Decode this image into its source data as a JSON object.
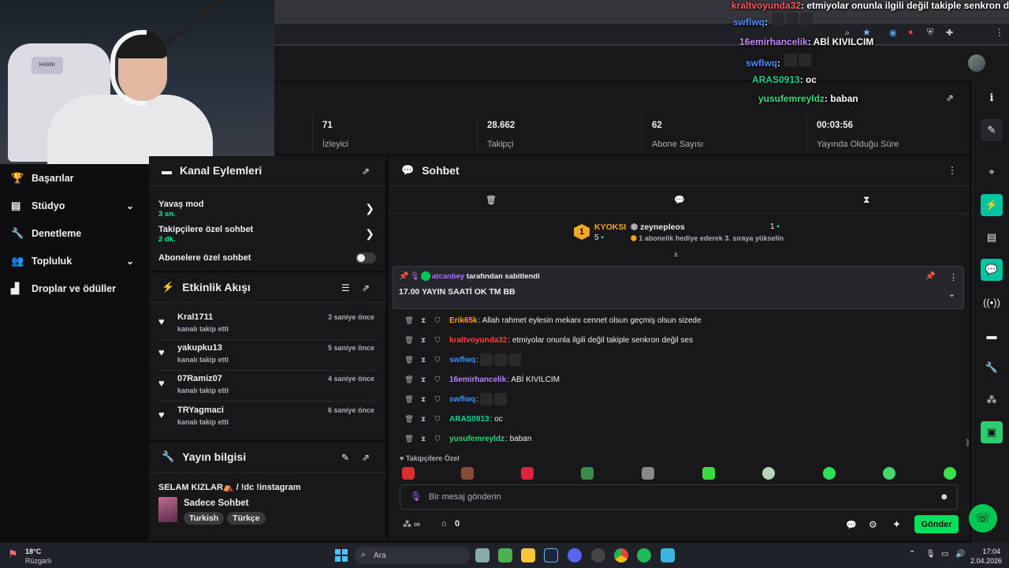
{
  "nav": [
    {
      "label": "Başarılar",
      "icon": "trophy-icon"
    },
    {
      "label": "Stüdyo",
      "icon": "studio-icon",
      "expand": true
    },
    {
      "label": "Denetleme",
      "icon": "wrench-icon"
    },
    {
      "label": "Topluluk",
      "icon": "community-icon",
      "expand": true
    },
    {
      "label": "Droplar ve ödüller",
      "icon": "drops-icon"
    }
  ],
  "stats": [
    {
      "value": "71",
      "label": "İzleyici"
    },
    {
      "value": "28.662",
      "label": "Takipçi"
    },
    {
      "value": "62",
      "label": "Abone Sayısı"
    },
    {
      "value": "00:03:56",
      "label": "Yayında Olduğu Süre"
    }
  ],
  "channel_actions": {
    "title": "Kanal Eylemleri",
    "slow_mode": {
      "label": "Yavaş mod",
      "value": "3 sn."
    },
    "followers_only": {
      "label": "Takipçilere özel sohbet",
      "value": "2 dk."
    },
    "subs_only": {
      "label": "Abonelere özel sohbet"
    }
  },
  "activity": {
    "title": "Etkinlik Akışı",
    "items": [
      {
        "name": "Kral1711",
        "sub": "kanalı takip etti",
        "time": "3 saniye önce"
      },
      {
        "name": "yakupku13",
        "sub": "kanalı takip etti",
        "time": "5 saniye önce"
      },
      {
        "name": "07Ramiz07",
        "sub": "kanalı takip etti",
        "time": "4 saniye önce"
      },
      {
        "name": "TRYagmaci",
        "sub": "kanalı takip etti",
        "time": "6 saniye önce"
      }
    ]
  },
  "stream_info": {
    "title_label": "Yayın bilgisi",
    "stream_title": "SELAM KIZLAR⛺ / !dc !instagram",
    "category": "Sadece Sohbet",
    "tags": [
      "Turkish",
      "Türkçe"
    ]
  },
  "chat": {
    "title": "Sohbet",
    "leaderboard": {
      "rank": "1",
      "top_user": "KYOKSI",
      "top_count": "5",
      "gifter": "zeynepleos",
      "gift_count": "1",
      "gift_hint": "1 abonelik hediye ederek 3. sıraya yükselin"
    },
    "pinned": {
      "by_user": "atcanbey",
      "by_text": "tarafından sabitlendi",
      "message": "17.00 YAYIN SAATİ OK TM BB"
    },
    "messages": [
      {
        "user": "Erik65k",
        "color": "#ff9f1a",
        "text": ": Allah rahmet eylesin mekanı cennet olsun geçmiş olsun sizede"
      },
      {
        "user": "kraltvoyunda32",
        "color": "#ff4040",
        "text": ": etmiyolar onunla ilgili değil takiple senkron değil ses"
      },
      {
        "user": "swflwq",
        "color": "#3d8bff",
        "text": ":",
        "emotes": 3
      },
      {
        "user": "16emirhancelik",
        "color": "#b980ff",
        "text": ": ABİ KIVILCIM"
      },
      {
        "user": "swflwq",
        "color": "#3d8bff",
        "text": ":",
        "emotes": 2
      },
      {
        "user": "ARAS0913",
        "color": "#00d68f",
        "text": ": oc"
      },
      {
        "user": "yusufemreyldz",
        "color": "#2ed573",
        "text": ": baban"
      }
    ],
    "followers_only_label": "Takipçilere Özel",
    "input_placeholder": "Bir mesaj gönderin",
    "points": "0",
    "send_label": "Gönder"
  },
  "overlay": [
    {
      "user": "kraltvoyunda32",
      "text": ": etmiyolar onunla ilgili değil takiple senkron deği"
    },
    {
      "user": "swflwq",
      "text": ":"
    },
    {
      "user": "16emirhancelik",
      "text": ": ABİ KIVILCIM"
    },
    {
      "user": "swflwq",
      "text": ":"
    },
    {
      "user": "ARAS0913",
      "text": ": oc"
    },
    {
      "user": "yusufemreyldz",
      "text": ": baban"
    }
  ],
  "webcam": {
    "chair_logo": "HAWK"
  },
  "taskbar": {
    "weather_temp": "18°C",
    "weather_desc": "Rüzgarlı",
    "search": "Ara",
    "time": "17:04",
    "date": "2.04.2026"
  }
}
